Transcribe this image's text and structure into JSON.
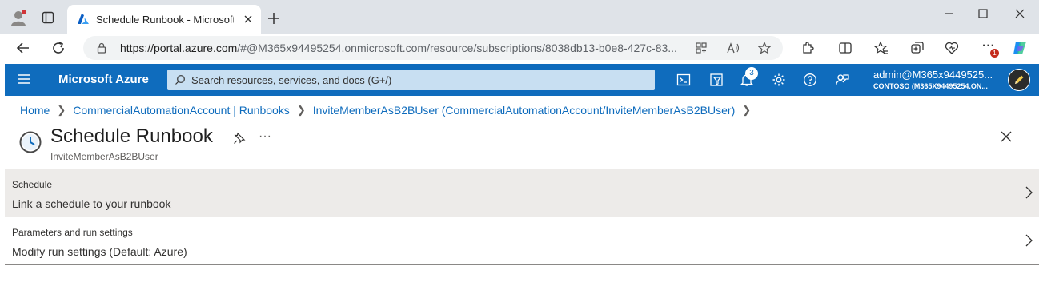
{
  "browser": {
    "tab_title": "Schedule Runbook - Microsoft Azure",
    "url_host": "https://portal.azure.com",
    "url_path": "/#@M365x94495254.onmicrosoft.com/resource/subscriptions/8038db13-b0e8-427c-83...",
    "extension_badge": "1"
  },
  "header": {
    "brand": "Microsoft Azure",
    "search_placeholder": "Search resources, services, and docs (G+/)",
    "notification_count": "3",
    "account_name": "admin@M365x9449525...",
    "account_tenant": "CONTOSO (M365X94495254.ON...",
    "accent_color": "#0f6cbd"
  },
  "breadcrumb": [
    "Home",
    "CommercialAutomationAccount | Runbooks",
    "InviteMemberAsB2BUser (CommercialAutomationAccount/InviteMemberAsB2BUser)"
  ],
  "page": {
    "title": "Schedule Runbook",
    "subtitle": "InviteMemberAsB2BUser",
    "more": "···"
  },
  "rows": [
    {
      "label": "Schedule",
      "value": "Link a schedule to your runbook",
      "selected": true
    },
    {
      "label": "Parameters and run settings",
      "value": "Modify run settings (Default: Azure)",
      "selected": false
    }
  ]
}
